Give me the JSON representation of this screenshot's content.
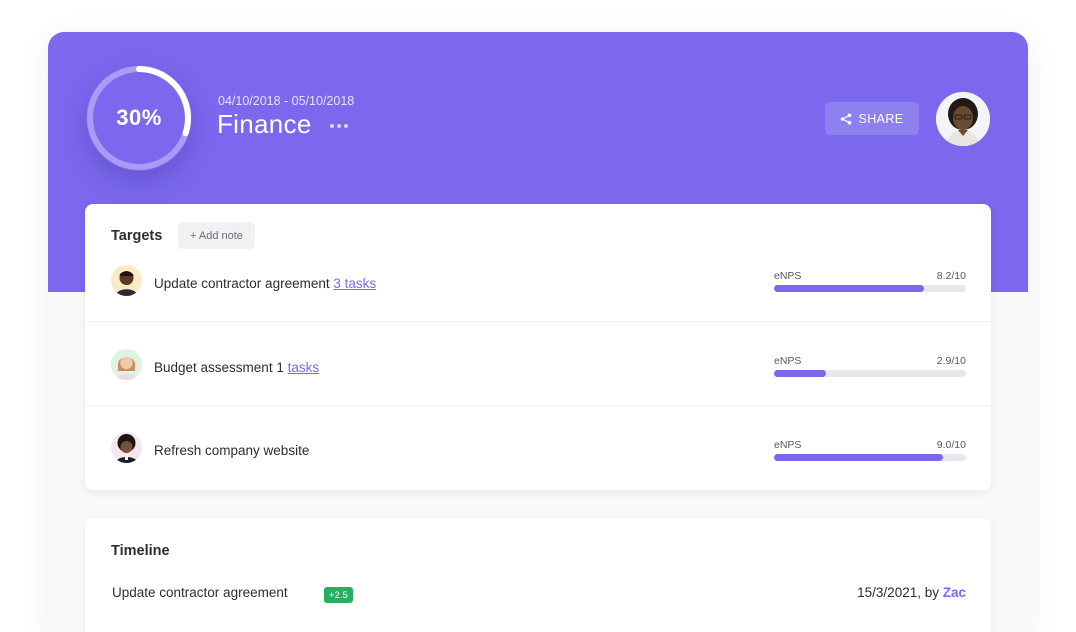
{
  "header": {
    "progress": "30%",
    "progress_fraction": 0.3,
    "date_range": "04/10/2018 - 05/10/2018",
    "title": "Finance",
    "more_icon": "more-horizontal-icon",
    "share_label": "SHARE",
    "share_icon": "share-icon",
    "accent": "#7b68ee"
  },
  "targets": {
    "title": "Targets",
    "add_note_label": "+ Add note",
    "rows": [
      {
        "label": "Update contractor agreement ",
        "task_count": "3",
        "task_link": "tasks",
        "metric_name": "eNPS",
        "metric_value": "8.2/10",
        "fill": 0.78
      },
      {
        "label": "Budget assessment 1",
        "task_count": "",
        "task_link": "tasks",
        "metric_name": "eNPS",
        "metric_value": "2.9/10",
        "fill": 0.27
      },
      {
        "label": "Refresh company website",
        "task_count": "",
        "task_link": "",
        "metric_name": "eNPS",
        "metric_value": "9.0/10",
        "fill": 0.88
      }
    ]
  },
  "timeline": {
    "title": "Timeline",
    "item_label": "Update contractor agreement",
    "delta": "+2.5",
    "date": "15/3/2021, by ",
    "author": "Zac",
    "badge_color": "#27ae60"
  }
}
